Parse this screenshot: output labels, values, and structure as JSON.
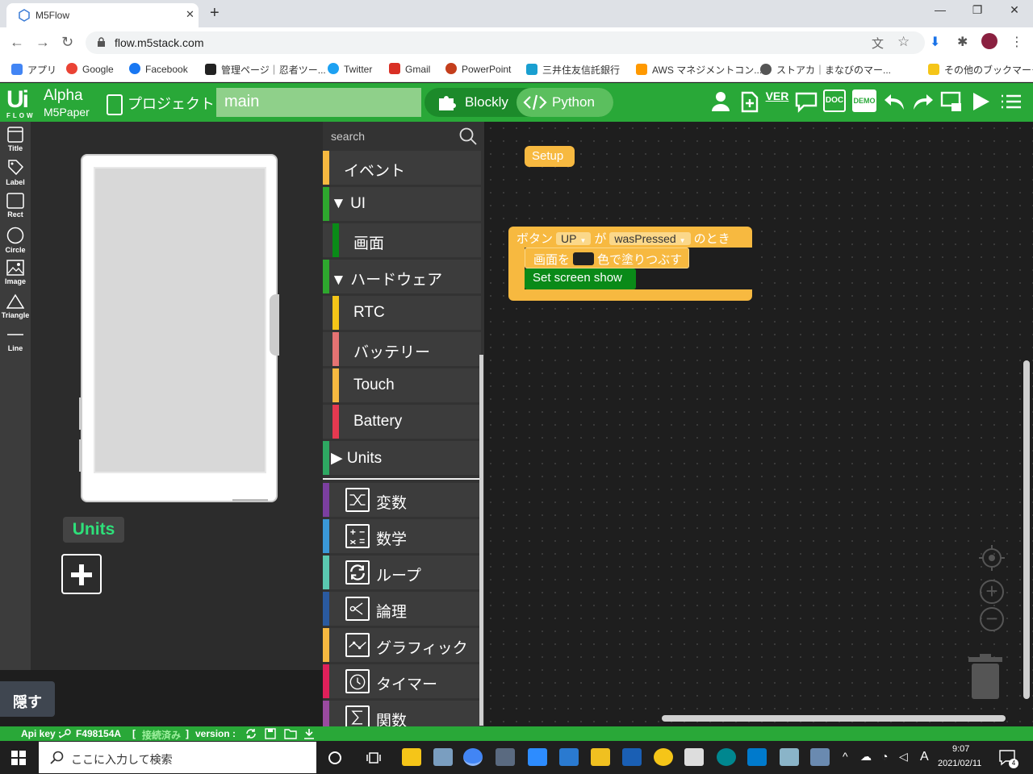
{
  "browser": {
    "tab_title": "M5Flow",
    "tab_close": "✕",
    "new_tab": "+",
    "url": "flow.m5stack.com",
    "window_controls": {
      "minimize": "—",
      "restore": "❐",
      "close": "✕"
    }
  },
  "bookmarks": [
    {
      "label": "アプリ",
      "color": "#4285f4"
    },
    {
      "label": "Google",
      "color": "#ea4335"
    },
    {
      "label": "Facebook",
      "color": "#1877f2"
    },
    {
      "label": "管理ページ｜忍者ツー...",
      "color": "#222222"
    },
    {
      "label": "Twitter",
      "color": "#1da1f2"
    },
    {
      "label": "Gmail",
      "color": "#d93025"
    },
    {
      "label": "PowerPoint",
      "color": "#c43e1c"
    },
    {
      "label": "三井住友信託銀行",
      "color": "#1a9fd0"
    },
    {
      "label": "AWS マネジメントコン...",
      "color": "#ff9900"
    },
    {
      "label": "ストアカ｜まなびのマー...",
      "color": "#555555"
    },
    {
      "label": "その他のブックマーク",
      "color": "#f5c518"
    }
  ],
  "app": {
    "logo_ui": "Ui",
    "logo_flow": "FLOW",
    "alpha": "Alpha",
    "device": "M5Paper",
    "project_label": "プロジェクト",
    "filename": "main",
    "blockly_label": "Blockly",
    "python_label": "Python",
    "header_icons": [
      "user-icon",
      "add-file-icon",
      "version-icon",
      "comment-icon",
      "doc-icon",
      "demo-icon",
      "undo-icon",
      "redo-icon",
      "device-icon",
      "run-icon",
      "menu-icon"
    ],
    "ver_text": "VER",
    "doc_text": "DOC",
    "demo_text": "DEMO"
  },
  "tools": [
    {
      "label": "Title"
    },
    {
      "label": "Label"
    },
    {
      "label": "Rect"
    },
    {
      "label": "Circle"
    },
    {
      "label": "Image"
    },
    {
      "label": "Triangle"
    },
    {
      "label": "Line"
    }
  ],
  "device_panel": {
    "units_label": "Units",
    "hide_label": "隠す"
  },
  "categories": {
    "search_placeholder": "search",
    "items": [
      {
        "label": "イベント",
        "color": "#f7b940"
      },
      {
        "label": "▼ UI",
        "color": "#2ea82e"
      },
      {
        "label": "画面",
        "color": "#0a8a18"
      },
      {
        "label": "▼ ハードウェア",
        "color": "#2ea82e"
      },
      {
        "label": "RTC",
        "color": "#f5c518"
      },
      {
        "label": "バッテリー",
        "color": "#e57373"
      },
      {
        "label": "Touch",
        "color": "#f7b940"
      },
      {
        "label": "Battery",
        "color": "#e53950"
      },
      {
        "label": "▶ Units",
        "color": "#2ea862"
      },
      {
        "label": "変数",
        "color": "#7b3fa0"
      },
      {
        "label": "数学",
        "color": "#3a98d8"
      },
      {
        "label": "ループ",
        "color": "#5ac8b0"
      },
      {
        "label": "論理",
        "color": "#2a5aa0"
      },
      {
        "label": "グラフィック",
        "color": "#f7b940"
      },
      {
        "label": "タイマー",
        "color": "#e0205a"
      },
      {
        "label": "関数",
        "color": "#9a4aa0"
      }
    ]
  },
  "workspace": {
    "setup_label": "Setup",
    "event_prefix": "ボタン",
    "event_button": "UP",
    "event_ga": "が",
    "event_action": "wasPressed",
    "event_suffix": "のとき",
    "fill_prefix": "画面を",
    "fill_suffix": "色で塗りつぶす",
    "show_label": "Set screen show",
    "zoom_in": "+",
    "zoom_out": "−"
  },
  "statusbar": {
    "api_key_label": "Api key :",
    "api_key_value": "F498154A",
    "connection_open": "[",
    "connection_status": "接続済み",
    "connection_close": "]",
    "version_label": "version :"
  },
  "taskbar": {
    "search_text": "ここに入力して検索",
    "time": "9:07",
    "date": "2021/02/11",
    "ime": "A",
    "notification_count": "4"
  }
}
